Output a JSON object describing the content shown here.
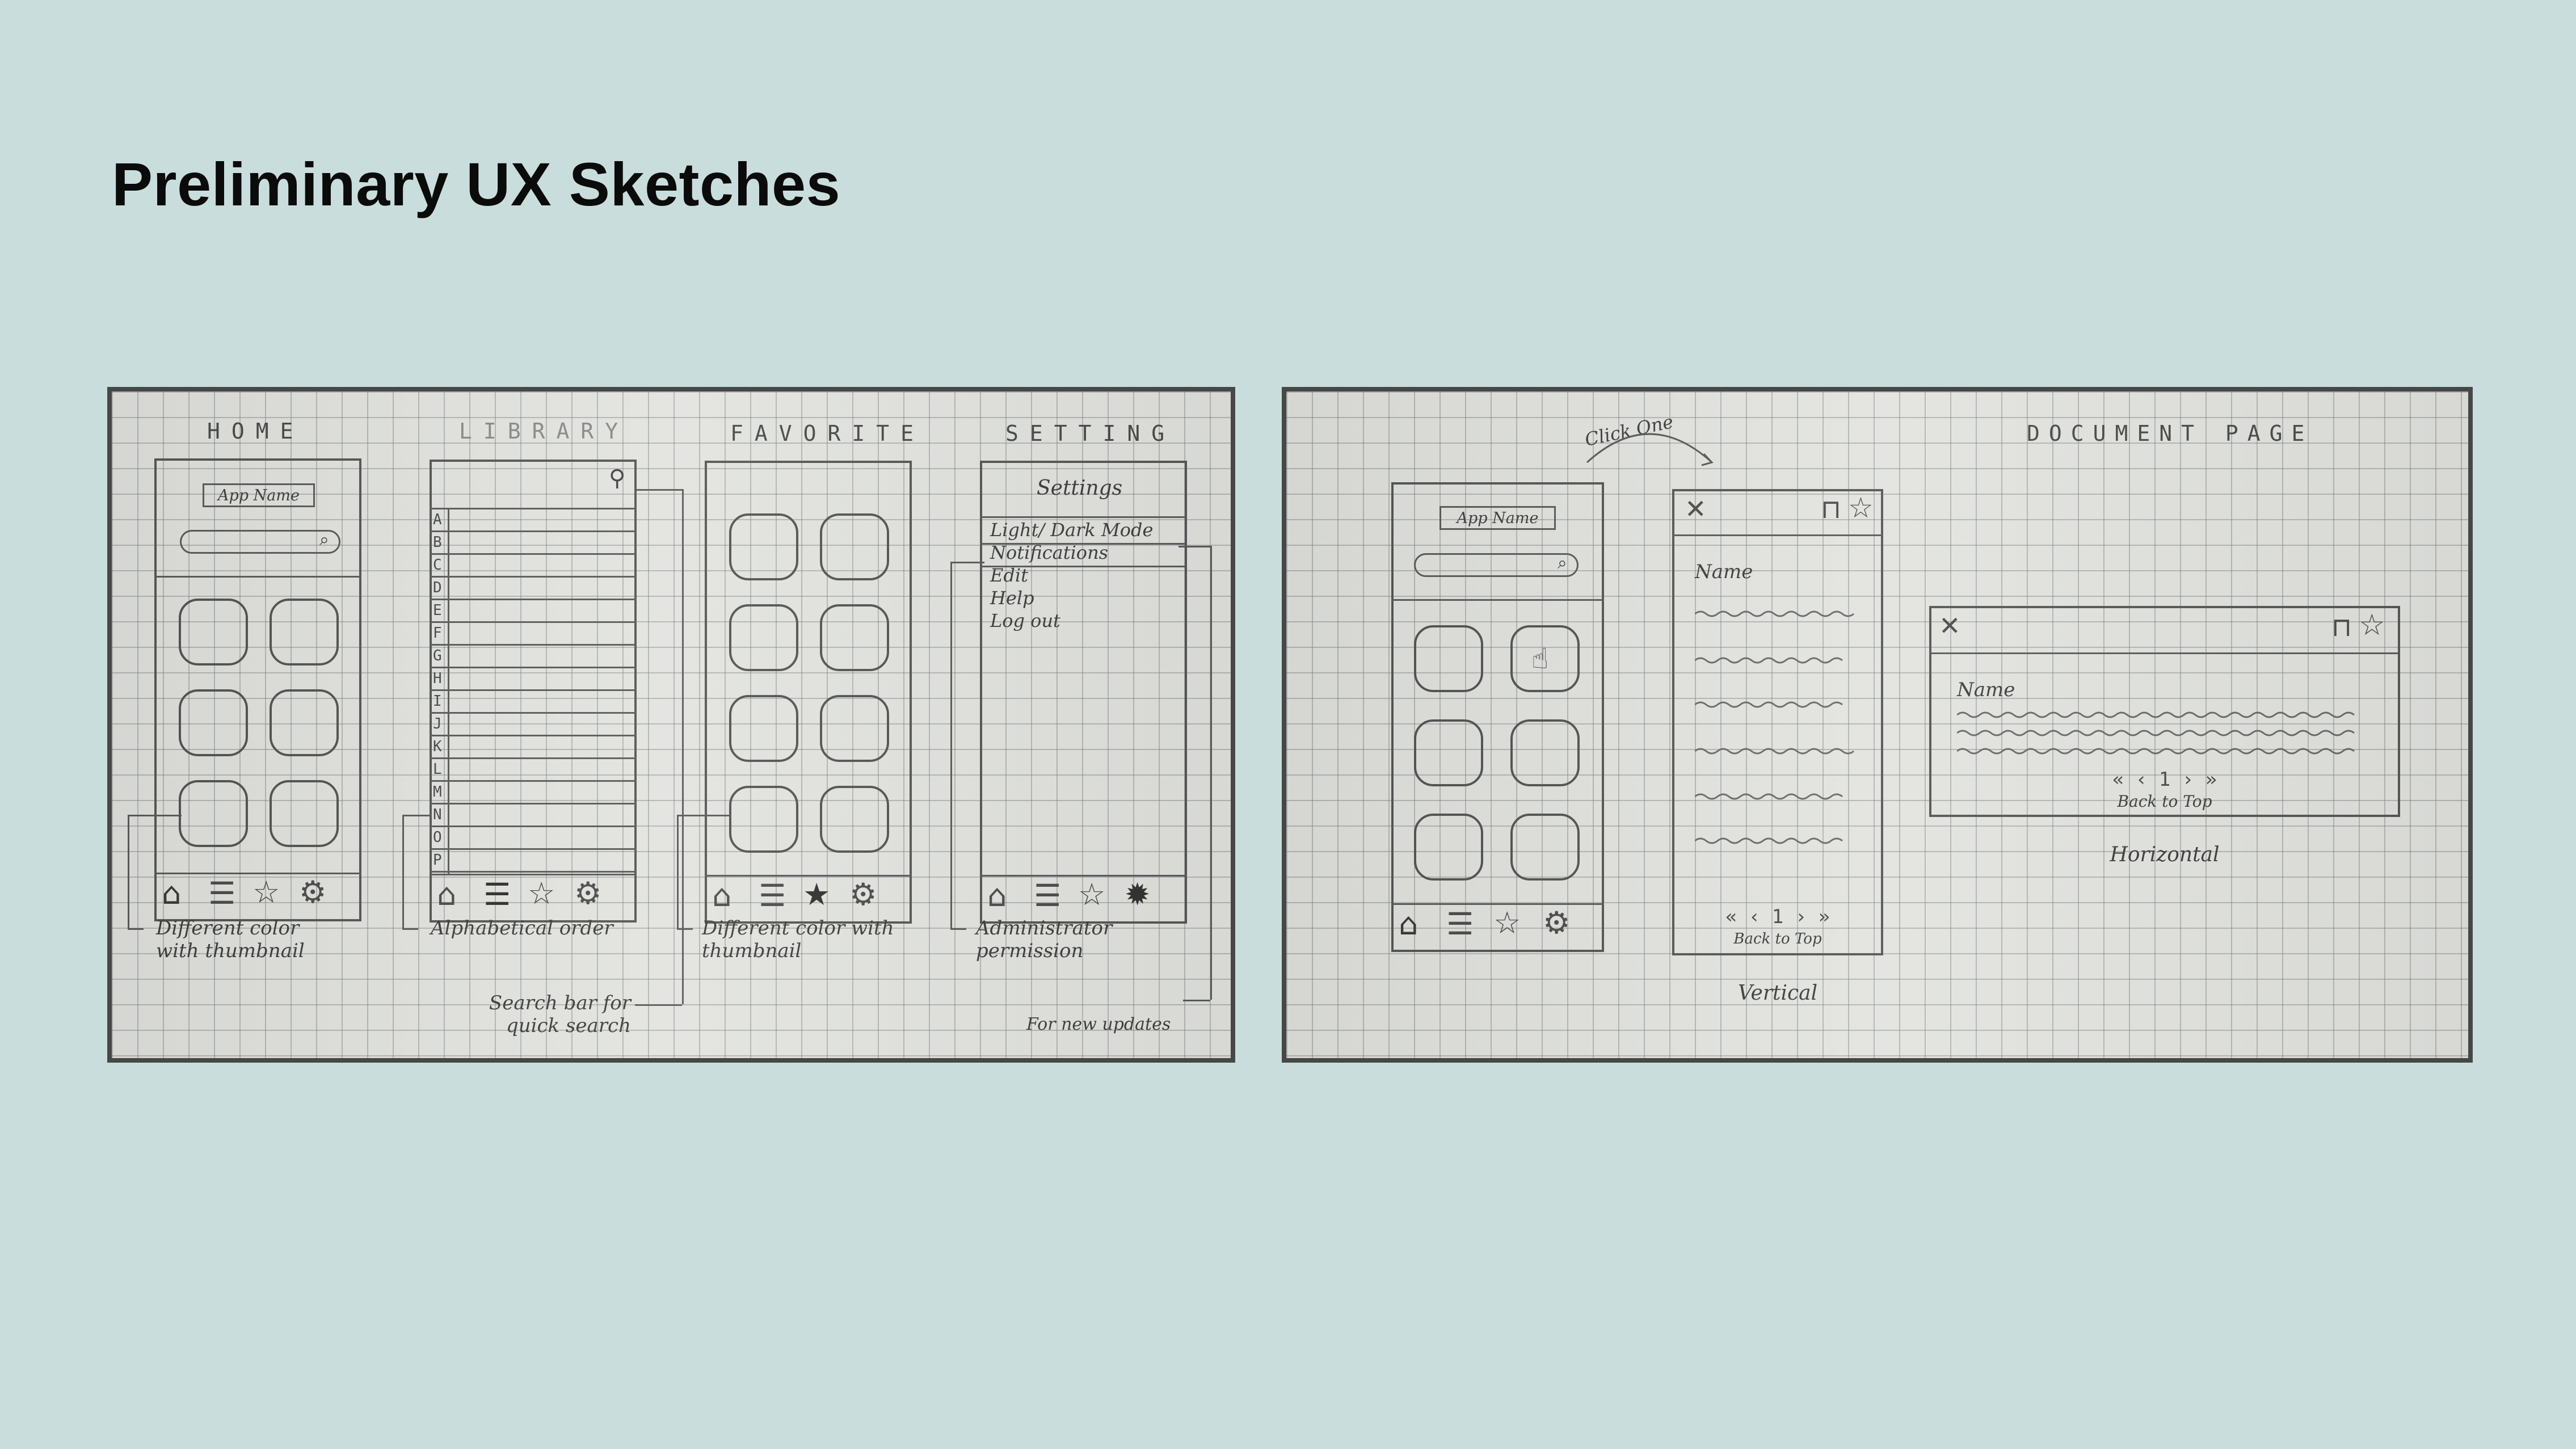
{
  "slide": {
    "title": "Preliminary UX Sketches"
  },
  "left_sketch": {
    "screens": {
      "home": "HOME",
      "library": "LIBRARY",
      "favorite": "FAVORITE",
      "setting": "SETTING"
    },
    "home": {
      "app_name": "App Name"
    },
    "library": {
      "letters": [
        "A",
        "B",
        "C",
        "D",
        "E",
        "F",
        "G",
        "H",
        "I",
        "J",
        "K",
        "L",
        "M",
        "N",
        "O",
        "P"
      ]
    },
    "settings": {
      "heading": "Settings",
      "items": [
        "Light/ Dark Mode",
        "Notifications",
        "Edit",
        "Help",
        "Log out"
      ]
    },
    "notes": {
      "home": "Different color with thumbnail",
      "library_order": "Alphabetical order",
      "library_search": "Search bar for quick search",
      "favorite": "Different color with thumbnail",
      "setting_admin": "Administrator permission",
      "setting_updates": "For new updates"
    }
  },
  "right_sketch": {
    "click_label": "Click One",
    "document_title": "DOCUMENT PAGE",
    "home": {
      "app_name": "App Name"
    },
    "vertical": {
      "name": "Name",
      "pager": "« ‹ 1 › »",
      "back_to_top": "Back to Top",
      "caption": "Vertical"
    },
    "horizontal": {
      "name": "Name",
      "pager": "« ‹ 1 › »",
      "back_to_top": "Back to Top",
      "caption": "Horizontal"
    }
  },
  "icons": [
    "home-icon",
    "list-icon",
    "star-icon",
    "gear-icon",
    "search-icon",
    "close-icon",
    "bookmark-icon",
    "hand-pointer-icon"
  ]
}
